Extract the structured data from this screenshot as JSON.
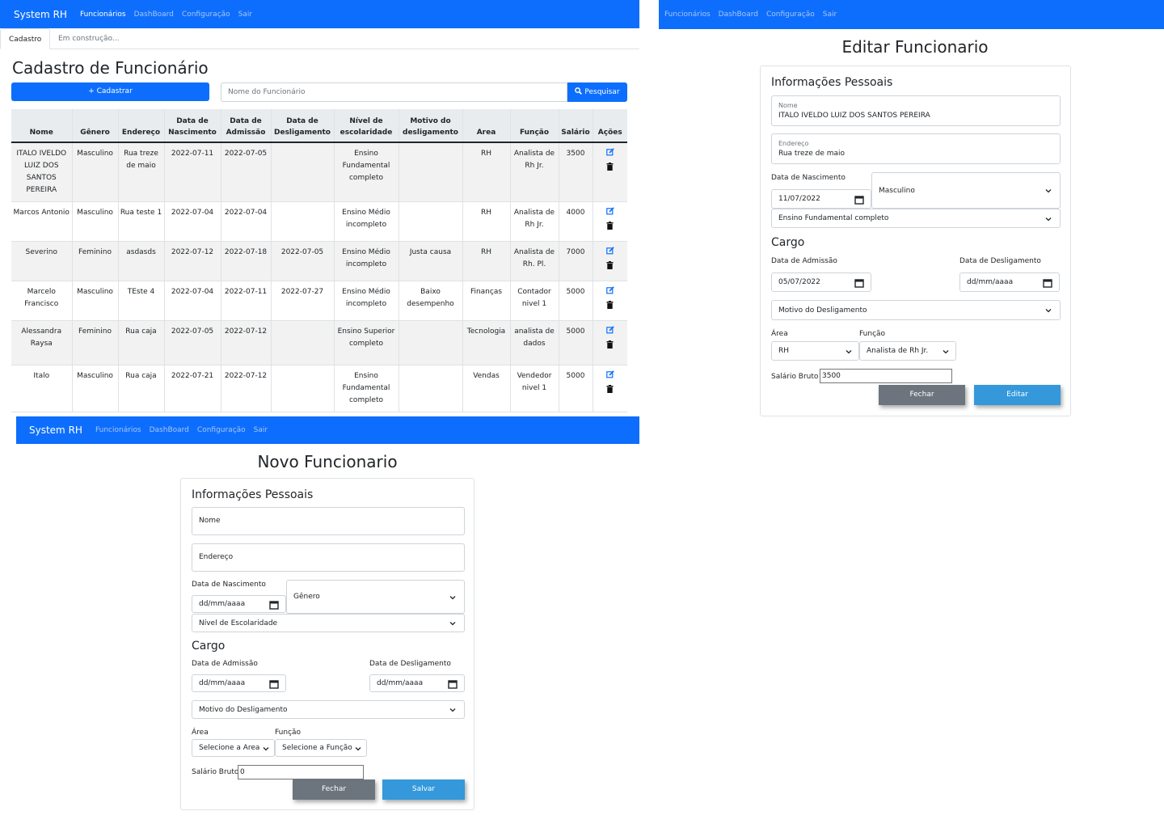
{
  "list_page": {
    "navbar": {
      "brand": "System RH",
      "links": [
        "Funcionários",
        "DashBoard",
        "Configuração",
        "Sair"
      ]
    },
    "tabs": [
      "Cadastro",
      "Em construção..."
    ],
    "title": "Cadastro de Funcionário",
    "add_button": "Cadastrar",
    "search_placeholder": "Nome do Funcionário",
    "search_button": "Pesquisar",
    "table": {
      "headers": [
        "Nome",
        "Gênero",
        "Endereço",
        "Data de Nascimento",
        "Data de Admissão",
        "Data de Desligamento",
        "Nível de escolaridade",
        "Motivo do desligamento",
        "Area",
        "Função",
        "Salário",
        "Ações"
      ],
      "rows": [
        [
          "ITALO IVELDO LUIZ DOS SANTOS PEREIRA",
          "Masculino",
          "Rua treze de maio",
          "2022-07-11",
          "2022-07-05",
          "",
          "Ensino Fundamental completo",
          "",
          "RH",
          "Analista de Rh Jr.",
          "3500"
        ],
        [
          "Marcos Antonio",
          "Masculino",
          "Rua teste 1",
          "2022-07-04",
          "2022-07-04",
          "",
          "Ensino Médio incompleto",
          "",
          "RH",
          "Analista de Rh Jr.",
          "4000"
        ],
        [
          "Severino",
          "Feminino",
          "asdasds",
          "2022-07-12",
          "2022-07-18",
          "2022-07-05",
          "Ensino Médio incompleto",
          "Justa causa",
          "RH",
          "Analista de Rh. Pl.",
          "7000"
        ],
        [
          "Marcelo Francisco",
          "Masculino",
          "TEste 4",
          "2022-07-04",
          "2022-07-11",
          "2022-07-27",
          "Ensino Médio incompleto",
          "Baixo desempenho",
          "Finanças",
          "Contador nivel 1",
          "5000"
        ],
        [
          "Alessandra Raysa",
          "Feminino",
          "Rua caja",
          "2022-07-05",
          "2022-07-12",
          "",
          "Ensino Superior completo",
          "",
          "Tecnologia",
          "analista de dados",
          "5000"
        ],
        [
          "Italo",
          "Masculino",
          "Rua caja",
          "2022-07-21",
          "2022-07-12",
          "",
          "Ensino Fundamental completo",
          "",
          "Vendas",
          "Vendedor nivel 1",
          "5000"
        ]
      ]
    }
  },
  "edit_page": {
    "navbar": {
      "links": [
        "Funcionários",
        "DashBoard",
        "Configuração",
        "Sair"
      ]
    },
    "title": "Editar Funcionario",
    "personal_title": "Informações Pessoais",
    "name_label": "Nome",
    "name_value": "ITALO IVELDO LUIZ DOS SANTOS PEREIRA",
    "address_label": "Endereço",
    "address_value": "Rua treze de maio",
    "birth_label": "Data de Nascimento",
    "birth_value": "11/07/2022",
    "gender_value": "Masculino",
    "education_value": "Ensino Fundamental completo",
    "cargo_title": "Cargo",
    "admission_label": "Data de Admissão",
    "admission_value": "05/07/2022",
    "dismissal_label": "Data de Desligamento",
    "dismissal_value": "dd/mm/aaaa",
    "reason_value": "Motivo do Desligamento",
    "area_label": "Área",
    "area_value": "RH",
    "role_label": "Função",
    "role_value": "Analista de Rh Jr.",
    "salary_label": "Salário Bruto",
    "salary_value": "3500",
    "close_button": "Fechar",
    "submit_button": "Editar"
  },
  "new_page": {
    "navbar": {
      "brand": "System RH",
      "links": [
        "Funcionários",
        "DashBoard",
        "Configuração",
        "Sair"
      ]
    },
    "title": "Novo Funcionario",
    "personal_title": "Informações Pessoais",
    "name_label": "Nome",
    "address_label": "Endereço",
    "birth_label": "Data de Nascimento",
    "birth_value": "dd/mm/aaaa",
    "gender_value": "Gênero",
    "education_value": "Nível de Escolaridade",
    "cargo_title": "Cargo",
    "admission_label": "Data de Admissão",
    "admission_value": "dd/mm/aaaa",
    "dismissal_label": "Data de Desligamento",
    "dismissal_value": "dd/mm/aaaa",
    "reason_value": "Motivo do Desligamento",
    "area_label": "Área",
    "area_value": "Selecione a Area",
    "role_label": "Função",
    "role_value": "Selecione a Função",
    "salary_label": "Salário Bruto",
    "salary_value": "0",
    "close_button": "Fechar",
    "submit_button": "Salvar"
  }
}
